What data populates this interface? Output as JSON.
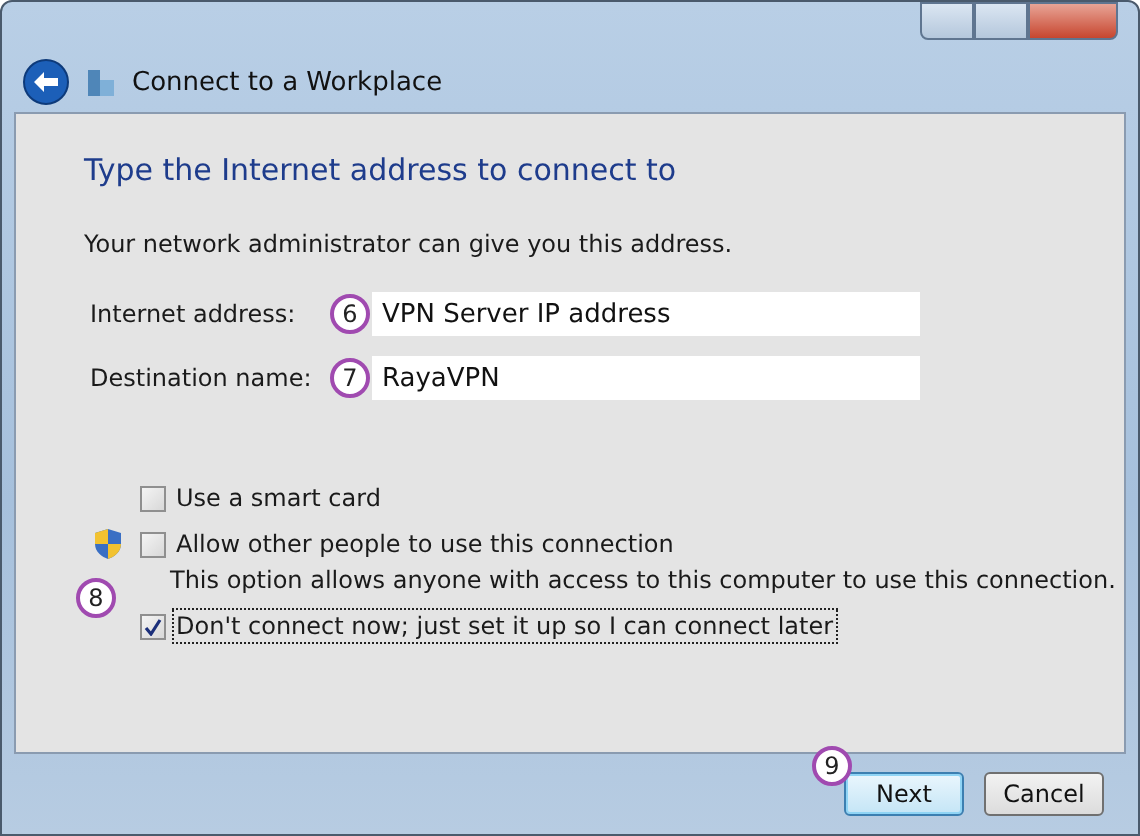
{
  "window": {
    "title": "Connect to a Workplace"
  },
  "heading": "Type the Internet address to connect to",
  "description": "Your network administrator can give you this address.",
  "fields": [
    {
      "label": "Internet address:",
      "value": "VPN Server IP address",
      "callout": "6"
    },
    {
      "label": "Destination name:",
      "value": "RayaVPN",
      "callout": "7"
    }
  ],
  "options": [
    {
      "label": "Use a smart card",
      "checked": false,
      "shield": false
    },
    {
      "label": "Allow other people to use this connection",
      "checked": false,
      "shield": true,
      "note": "This option allows anyone with access to this computer to use this connection."
    },
    {
      "label": "Don't connect now; just set it up so I can connect later",
      "checked": true,
      "shield": false,
      "focused": true,
      "callout": "8"
    }
  ],
  "buttons": [
    {
      "label": "Next",
      "default": true,
      "callout": "9"
    },
    {
      "label": "Cancel",
      "default": false
    }
  ]
}
